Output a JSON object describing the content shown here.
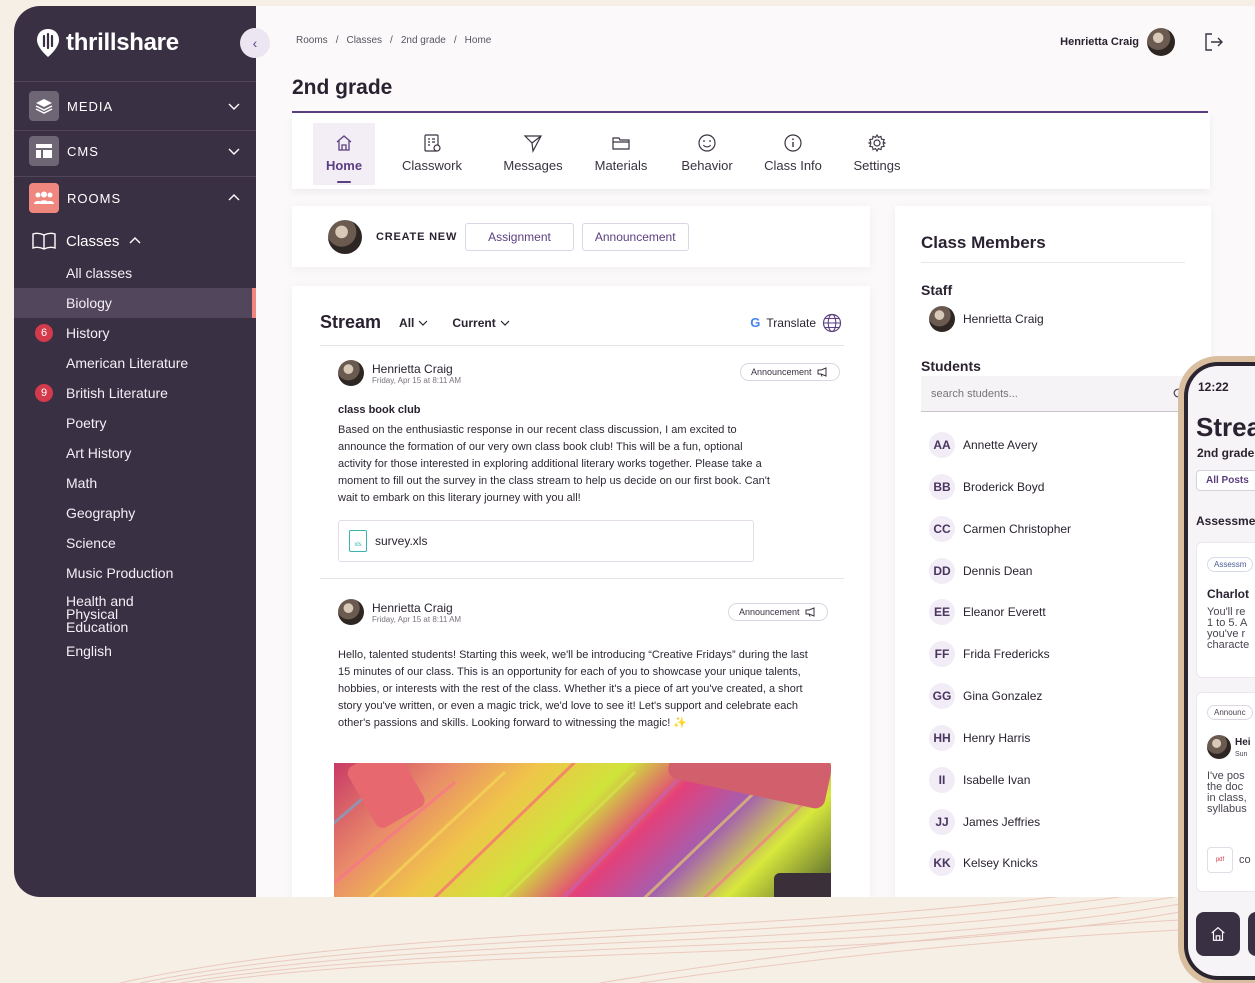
{
  "brand": {
    "name": "thrillshare"
  },
  "sidebar": {
    "sections": [
      {
        "label": "MEDIA",
        "icon": "layers-icon"
      },
      {
        "label": "CMS",
        "icon": "layout-icon"
      },
      {
        "label": "ROOMS",
        "icon": "people-icon"
      }
    ],
    "classes_label": "Classes",
    "items": [
      {
        "label": "All classes"
      },
      {
        "label": "Biology",
        "active": true
      },
      {
        "label": "History",
        "badge": "6"
      },
      {
        "label": "American Literature"
      },
      {
        "label": "British Literature",
        "badge": "9"
      },
      {
        "label": "Poetry"
      },
      {
        "label": "Art History"
      },
      {
        "label": "Math"
      },
      {
        "label": "Geography"
      },
      {
        "label": "Science"
      },
      {
        "label": "Music Production"
      },
      {
        "label": "Health and Physical Education"
      },
      {
        "label": "English"
      }
    ]
  },
  "breadcrumb": [
    "Rooms",
    "Classes",
    "2nd grade",
    "Home"
  ],
  "breadcrumb_sep": "/",
  "user": {
    "name": "Henrietta Craig"
  },
  "page_title": "2nd grade",
  "tabs": [
    {
      "label": "Home",
      "icon": "house-icon",
      "active": true
    },
    {
      "label": "Classwork",
      "icon": "clipboard-icon"
    },
    {
      "label": "Messages",
      "icon": "send-icon"
    },
    {
      "label": "Materials",
      "icon": "folder-icon"
    },
    {
      "label": "Behavior",
      "icon": "smile-icon"
    },
    {
      "label": "Class Info",
      "icon": "info-icon"
    },
    {
      "label": "Settings",
      "icon": "gear-icon"
    }
  ],
  "create": {
    "label": "CREATE NEW",
    "assignment": "Assignment",
    "announcement": "Announcement"
  },
  "stream": {
    "title": "Stream",
    "filter_all": "All",
    "filter_current": "Current",
    "translate": "Translate",
    "posts": [
      {
        "author": "Henrietta Craig",
        "date": "Friday, Apr 15 at 8:11 AM",
        "tag": "Announcement",
        "title": "class book club",
        "body": "Based on the enthusiastic response in our recent class discussion, I am excited to announce the formation of our very own class book club! This will be a fun, optional activity for those interested in exploring additional literary works together. Please take a moment to fill out the survey in the class stream to help us decide on our first book. Can't wait to embark on this literary journey with you all!",
        "attachment": "survey.xls",
        "attachment_ext": "xls"
      },
      {
        "author": "Henrietta Craig",
        "date": "Friday, Apr 15 at 8:11 AM",
        "tag": "Announcement",
        "body": "Hello, talented students! Starting this week, we'll be introducing “Creative Fridays” during the last 15 minutes of our class. This is an opportunity for each of you to showcase your unique talents, hobbies, or interests with the rest of the class. Whether it's a piece of art you've created, a short story you've written, or even a magic trick, we'd love to see it! Let's support and celebrate each other's passions and skills. Looking forward to witnessing the magic! ✨"
      }
    ]
  },
  "members": {
    "title": "Class Members",
    "staff_label": "Staff",
    "staff": [
      "Henrietta Craig"
    ],
    "students_label": "Students",
    "search_placeholder": "search students...",
    "students": [
      {
        "initials": "AA",
        "name": "Annette Avery"
      },
      {
        "initials": "BB",
        "name": "Broderick Boyd"
      },
      {
        "initials": "CC",
        "name": "Carmen Christopher"
      },
      {
        "initials": "DD",
        "name": "Dennis Dean"
      },
      {
        "initials": "EE",
        "name": "Eleanor Everett"
      },
      {
        "initials": "FF",
        "name": "Frida Fredericks"
      },
      {
        "initials": "GG",
        "name": "Gina Gonzalez"
      },
      {
        "initials": "HH",
        "name": "Henry Harris"
      },
      {
        "initials": "II",
        "name": "Isabelle Ivan"
      },
      {
        "initials": "JJ",
        "name": "James Jeffries"
      },
      {
        "initials": "KK",
        "name": "Kelsey Knicks"
      }
    ]
  },
  "phone": {
    "time": "12:22",
    "title": "Strea",
    "subtitle": "2nd grade",
    "chip": "All Posts",
    "section": "Assessme",
    "card1_tag": "Assessm",
    "card1_title": "Charlot",
    "card1_lines": [
      "You'll re",
      "1 to 5. A",
      "you've r",
      "characte"
    ],
    "card2_tag": "Announc",
    "card2_author": "Hei",
    "card2_date": "Sun",
    "card2_lines": [
      "I've pos",
      "the doc",
      "in class,",
      "syllabus"
    ],
    "card2_file": "co",
    "card2_file_ext": "pdf"
  },
  "colors": {
    "sidebar": "#3a3043",
    "accent": "#5b3f80",
    "rooms": "#f0877e",
    "badge": "#d33a4b"
  }
}
